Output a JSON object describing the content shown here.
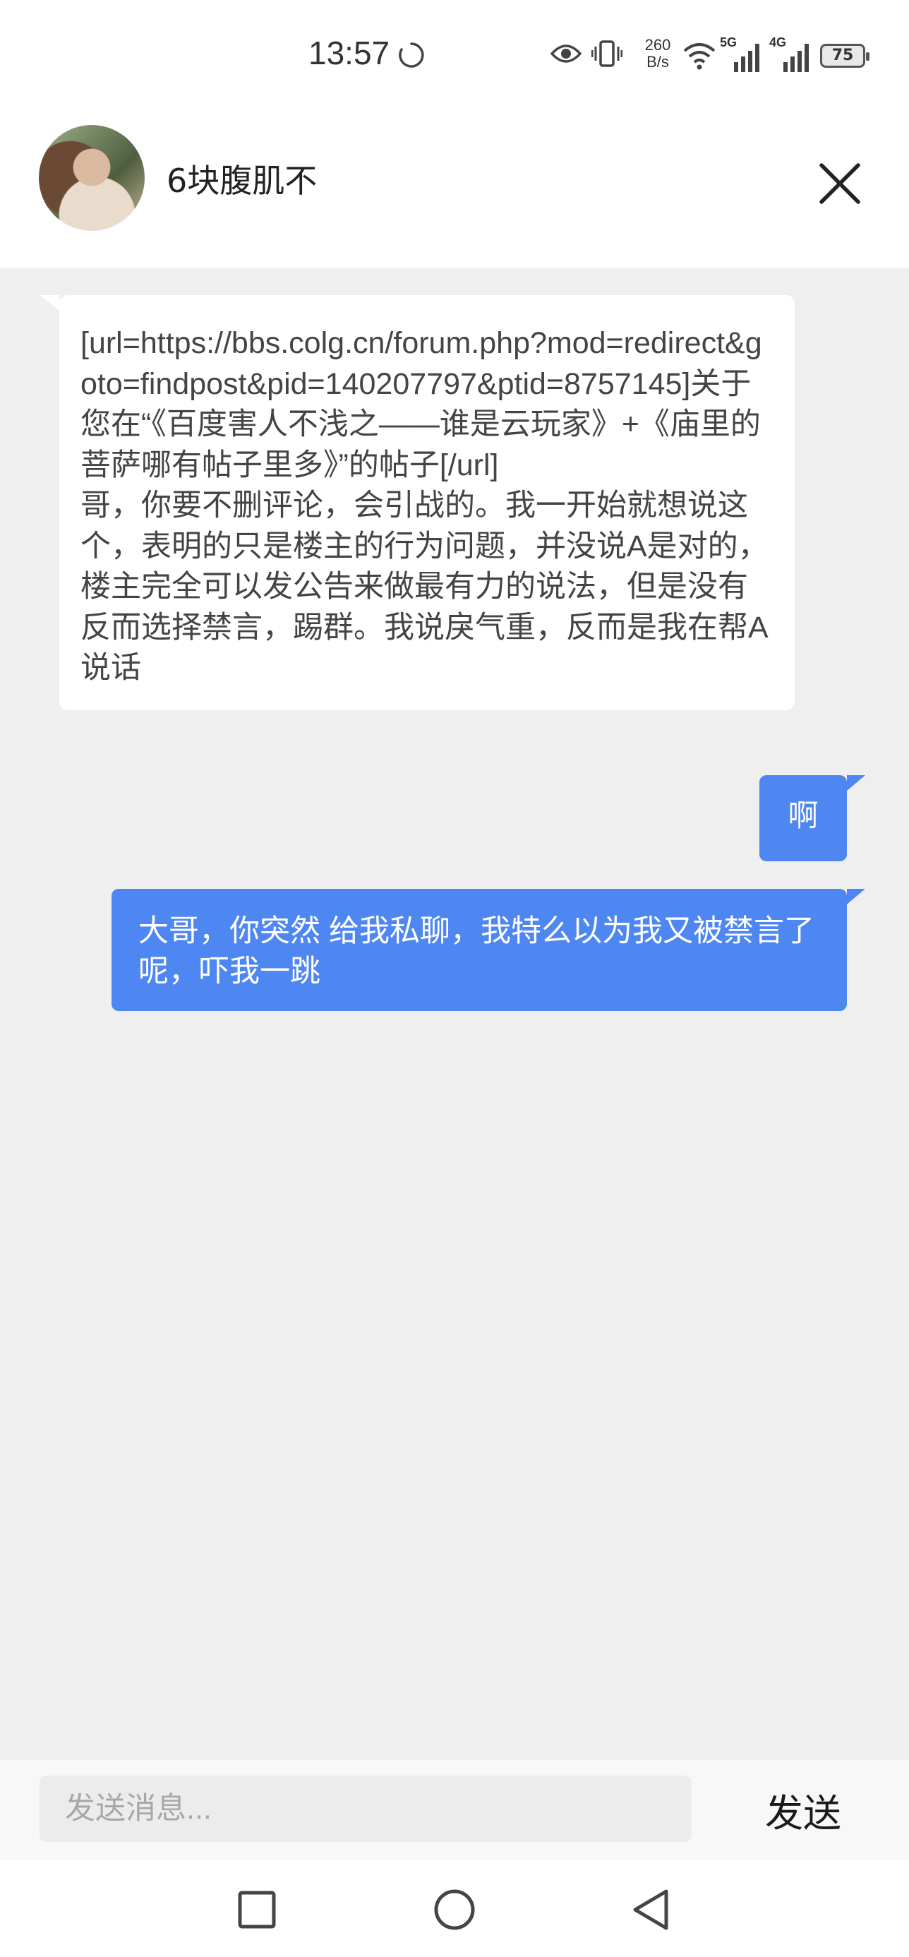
{
  "status_bar": {
    "time": "13:57",
    "net_speed_value": "260",
    "net_speed_unit": "B/s",
    "signal1_label": "5G",
    "signal2_label": "4G",
    "battery_level": "75"
  },
  "chat": {
    "contact_name": "6块腹肌不"
  },
  "messages": [
    {
      "direction": "incoming",
      "text": "[url=https://bbs.colg.cn/forum.php?mod=redirect&goto=findpost&pid=140207797&ptid=8757145]关于您在“《百度害人不浅之——谁是云玩家》+《庙里的菩萨哪有帖子里多》”的帖子[/url]\n哥，你要不删评论，会引战的。我一开始就想说这个，表明的只是楼主的行为问题，并没说A是对的，楼主完全可以发公告来做最有力的说法，但是没有反而选择禁言，踢群。我说戾气重，反而是我在帮A说话"
    },
    {
      "direction": "outgoing",
      "text": "啊"
    },
    {
      "direction": "outgoing",
      "text": "大哥，你突然 给我私聊，我特么以为我又被禁言了呢，吓我一跳"
    }
  ],
  "composer": {
    "placeholder": "发送消息...",
    "value": "",
    "send_label": "发送"
  },
  "colors": {
    "outgoing_bubble": "#4f87f2",
    "incoming_bubble": "#ffffff",
    "chat_background": "#efefef"
  },
  "icons": [
    "loading-icon",
    "eye-icon",
    "vibrate-icon",
    "wifi-icon",
    "signal-icon",
    "battery-icon",
    "close-icon",
    "recents-icon",
    "home-icon",
    "back-icon"
  ]
}
